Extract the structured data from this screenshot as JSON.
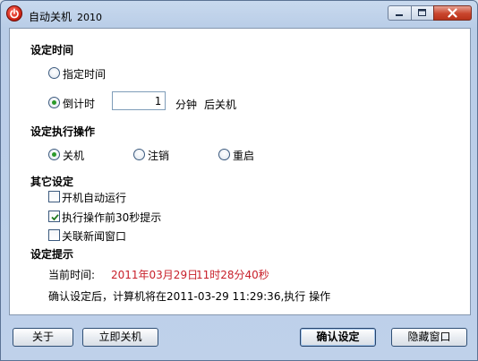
{
  "window": {
    "title": "自动关机",
    "version": "2010"
  },
  "set_time": {
    "heading": "设定时间",
    "option_specific": "指定时间",
    "option_countdown": "倒计时",
    "selected": "countdown",
    "minutes_value": "1",
    "minutes_unit": "分钟",
    "after_suffix": "后关机"
  },
  "action": {
    "heading": "设定执行操作",
    "options": [
      "关机",
      "注销",
      "重启"
    ],
    "selected": "关机"
  },
  "other": {
    "heading": "其它设定",
    "autostart": {
      "label": "开机自动运行",
      "checked": false
    },
    "notify": {
      "label": "执行操作前30秒提示",
      "checked": true
    },
    "close_news": {
      "label": "关联新闻窗口",
      "checked": false
    }
  },
  "hint": {
    "heading": "设定提示",
    "current_time_label": "当前时间:",
    "current_date": "2011年03月29日",
    "current_clock": "11时28分40秒",
    "confirm_text": "确认设定后，计算机将在2011-03-29 11:29:36,执行  操作"
  },
  "buttons": {
    "about": "关于",
    "shutdown_now": "立即关机",
    "confirm": "确认设定",
    "hide": "隐藏窗口"
  },
  "colors": {
    "accent_red": "#c8202a",
    "radio_dot": "#2a9a2a",
    "window_frame": "#bfd1ea"
  },
  "icons": {
    "app": "power-icon",
    "minimize": "minimize-icon",
    "maximize": "maximize-icon",
    "close": "close-icon",
    "check": "checkmark-icon"
  }
}
